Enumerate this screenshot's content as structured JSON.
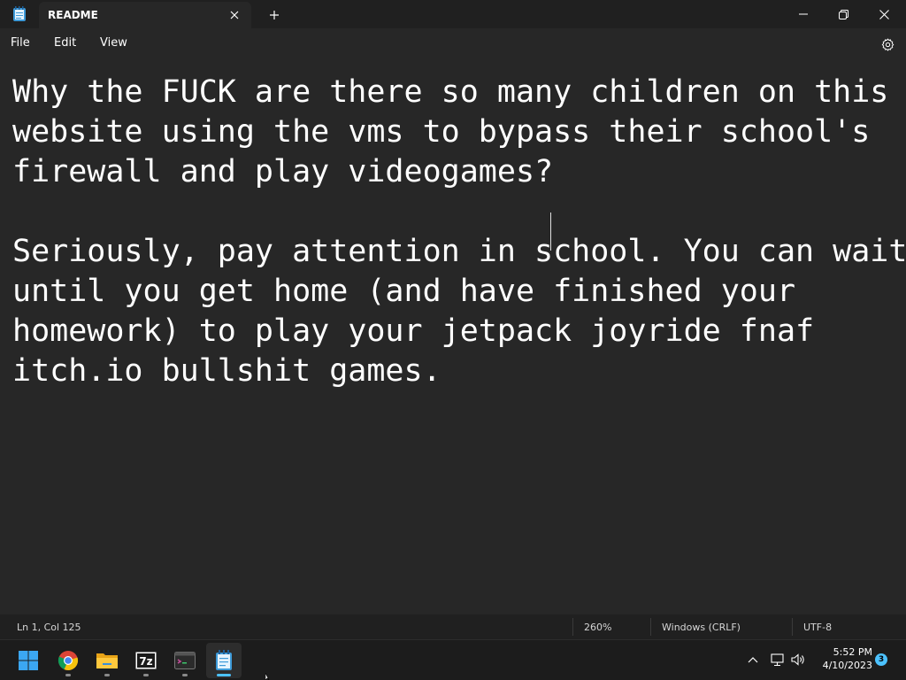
{
  "window": {
    "tab_title": "README",
    "new_tab_glyph": "+"
  },
  "menu": {
    "file": "File",
    "edit": "Edit",
    "view": "View"
  },
  "editor": {
    "content": "Why the FUCK are there so many children on this\nwebsite using the vms to bypass their school's\nfirewall and play videogames?\n\nSeriously, pay attention in school. You can wait\nuntil you get home (and have finished your\nhomework) to play your jetpack joyride fnaf\nitch.io bullshit games."
  },
  "status": {
    "position": "Ln 1, Col 125",
    "zoom": "260%",
    "line_ending": "Windows (CRLF)",
    "encoding": "UTF-8"
  },
  "taskbar": {
    "apps": [
      {
        "name": "start-icon"
      },
      {
        "name": "chrome-icon"
      },
      {
        "name": "file-explorer-icon"
      },
      {
        "name": "7zip-icon",
        "label": "7z"
      },
      {
        "name": "terminal-icon"
      },
      {
        "name": "notepad-icon"
      }
    ],
    "time": "5:52 PM",
    "date": "4/10/2023",
    "notification_count": "3"
  },
  "colors": {
    "background": "#272727",
    "titlebar": "#202020",
    "accent": "#4cc2ff"
  }
}
